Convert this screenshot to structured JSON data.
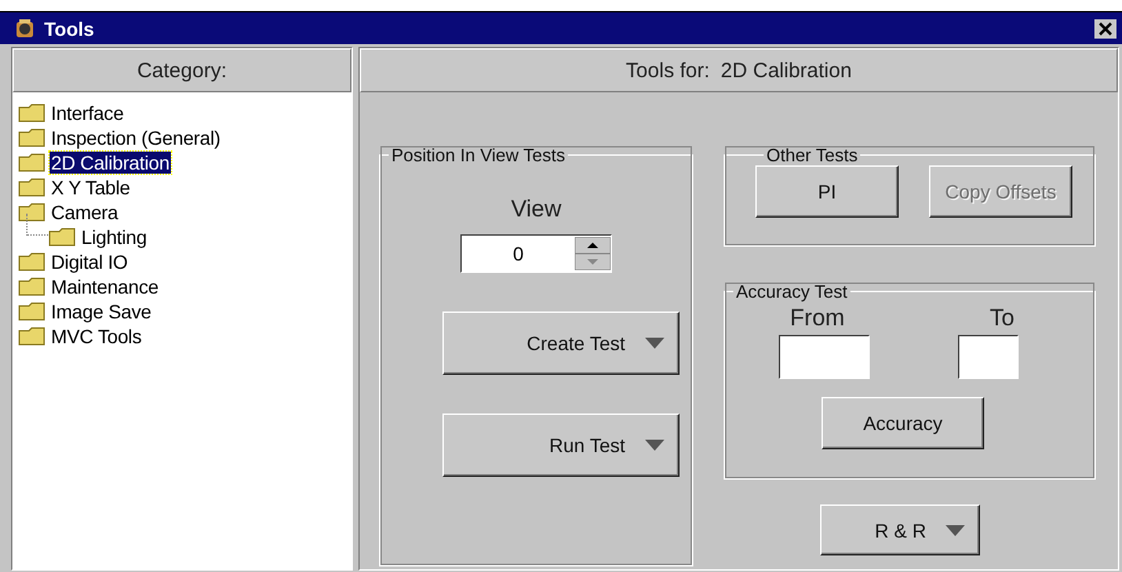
{
  "window": {
    "title": "Tools"
  },
  "category_panel": {
    "header": "Category:",
    "items": [
      {
        "label": "Interface",
        "selected": false
      },
      {
        "label": "Inspection (General)",
        "selected": false
      },
      {
        "label": "2D Calibration",
        "selected": true
      },
      {
        "label": "X Y Table",
        "selected": false
      },
      {
        "label": "Camera",
        "selected": false,
        "children": [
          {
            "label": "Lighting",
            "selected": false
          }
        ]
      },
      {
        "label": "Digital IO",
        "selected": false
      },
      {
        "label": "Maintenance",
        "selected": false
      },
      {
        "label": "Image Save",
        "selected": false
      },
      {
        "label": "MVC Tools",
        "selected": false
      }
    ]
  },
  "tools_panel": {
    "header_label": "Tools for:",
    "header_value": "2D Calibration",
    "position_group": {
      "title": "Position In View Tests",
      "view_label": "View",
      "view_value": "0",
      "buttons": [
        {
          "label": "Create Test",
          "menu": true,
          "disabled": false
        },
        {
          "label": "Run Test",
          "menu": true,
          "disabled": false
        }
      ]
    },
    "other_group": {
      "title": "Other Tests",
      "buttons": [
        {
          "label": "PI",
          "menu": false,
          "disabled": false
        },
        {
          "label": "Copy Offsets",
          "menu": false,
          "disabled": true
        }
      ]
    },
    "accuracy_group": {
      "title": "Accuracy Test",
      "from_label": "From",
      "to_label": "To",
      "button": {
        "label": "Accuracy",
        "menu": false,
        "disabled": false
      }
    },
    "rr_button": {
      "label": "R & R",
      "menu": true,
      "disabled": false
    }
  }
}
